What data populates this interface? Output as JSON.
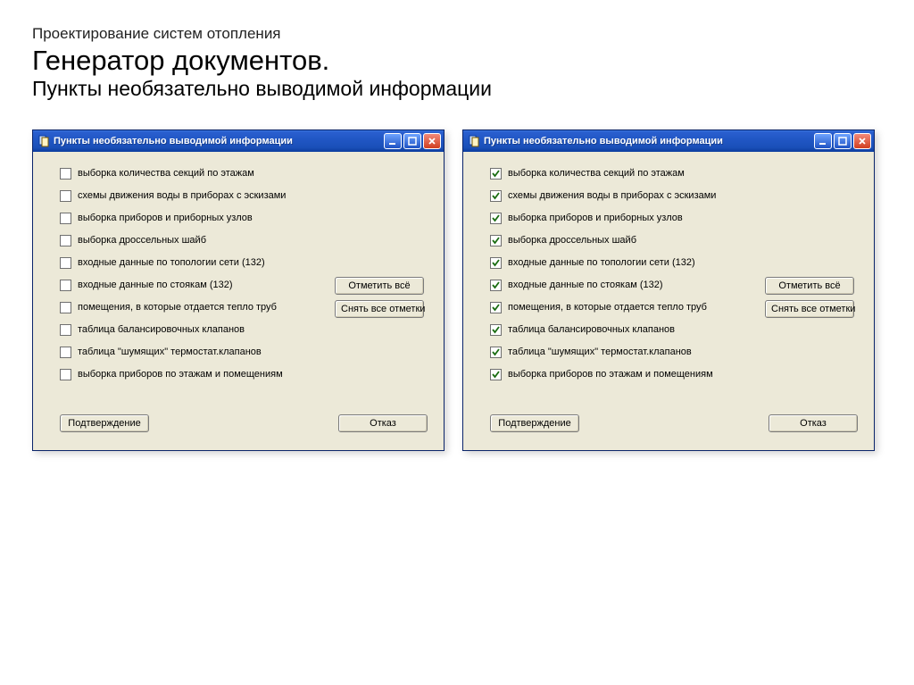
{
  "page": {
    "pre_title": "Проектирование систем отопления",
    "title_line1": "Генератор документов.",
    "title_line2": "Пункты необязательно выводимой информации"
  },
  "dialog": {
    "window_title": "Пункты необязательно выводимой информации",
    "buttons": {
      "select_all": "Отметить всё",
      "deselect_all": "Снять все отметки",
      "confirm": "Подтверждение",
      "cancel": "Отказ"
    },
    "items": [
      "выборка количества секций по этажам",
      "схемы движения воды в приборах с эскизами",
      "выборка приборов и приборных узлов",
      "выборка дроссельных шайб",
      "входные данные по топологии сети (132)",
      "входные данные по стоякам (132)",
      "помещения, в которые отдается тепло труб",
      "таблица балансировочных клапанов",
      "таблица \"шумящих\" термостат.клапанов",
      "выборка приборов по этажам и помещениям"
    ]
  },
  "dialog1_checked": [
    false,
    false,
    false,
    false,
    false,
    false,
    false,
    false,
    false,
    false
  ],
  "dialog2_checked": [
    true,
    true,
    true,
    true,
    true,
    true,
    true,
    true,
    true,
    true
  ]
}
